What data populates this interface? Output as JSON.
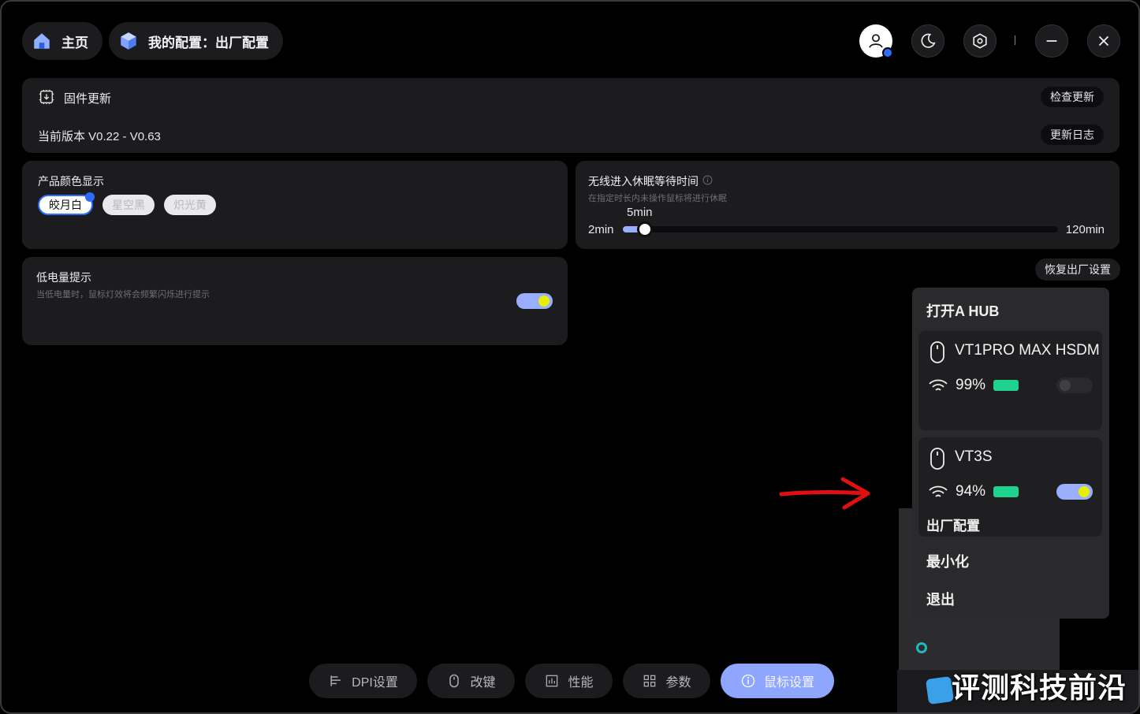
{
  "header": {
    "home_label": "主页",
    "config_label": "我的配置：出厂配置"
  },
  "firmware": {
    "title": "固件更新",
    "version": "当前版本 V0.22 - V0.63",
    "check_update": "检查更新",
    "changelog": "更新日志"
  },
  "color_display": {
    "title": "产品颜色显示",
    "options": [
      "皎月白",
      "星空黑",
      "炽光黄"
    ],
    "selected": "皎月白"
  },
  "sleep": {
    "title": "无线进入休眠等待时间",
    "subtitle": "在指定时长内未操作鼠标将进行休眠",
    "min_label": "2min",
    "max_label": "120min",
    "current_label": "5min",
    "min": 2,
    "max": 120,
    "value": 5
  },
  "low_battery": {
    "title": "低电量提示",
    "subtitle": "当低电量时，鼠标灯效将会频繁闪烁进行提示",
    "enabled": true
  },
  "factory_reset": "恢复出厂设置",
  "bottom_nav": [
    {
      "label": "DPI设置",
      "icon": "dpi-icon",
      "active": false
    },
    {
      "label": "改键",
      "icon": "mouse-icon",
      "active": false
    },
    {
      "label": "性能",
      "icon": "performance-icon",
      "active": false
    },
    {
      "label": "参数",
      "icon": "grid-icon",
      "active": false
    },
    {
      "label": "鼠标设置",
      "icon": "info-icon",
      "active": true
    }
  ],
  "tray_menu": {
    "open_label": "打开A HUB",
    "devices": [
      {
        "name": "VT1PRO MAX HSDM",
        "battery": "99%",
        "enabled": false,
        "profile": ""
      },
      {
        "name": "VT3S",
        "battery": "94%",
        "enabled": true,
        "profile": "出厂配置"
      }
    ],
    "minimize": "最小化",
    "exit": "退出"
  },
  "watermark": "评测科技前沿",
  "colors": {
    "accent": "#8fa6ff",
    "toggle_knob": "#e8f000",
    "battery": "#1fd38f",
    "arrow": "#e01010"
  }
}
